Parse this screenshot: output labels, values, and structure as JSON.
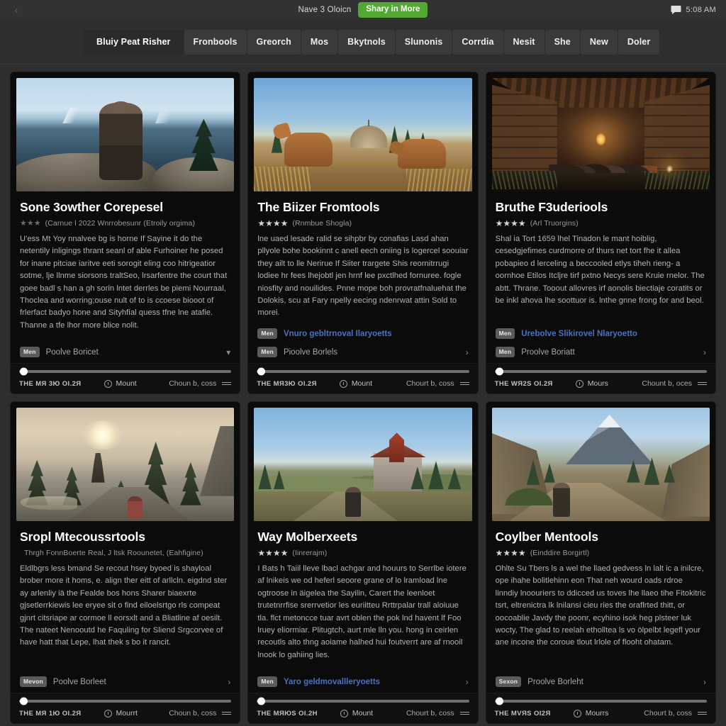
{
  "statusbar": {
    "back_icon": "chevron-left-icon",
    "title": "Nave 3 Oloicn",
    "pill_label": "Shary in More",
    "chat_icon": "chat-bubble-icon",
    "clock": "5:08 AM"
  },
  "tabs": [
    {
      "label": "Bluiy Peat Risher",
      "active": true
    },
    {
      "label": "Fronbools",
      "active": false
    },
    {
      "label": "Greorch",
      "active": false
    },
    {
      "label": "Mos",
      "active": false
    },
    {
      "label": "Bkytnols",
      "active": false
    },
    {
      "label": "Slunonis",
      "active": false
    },
    {
      "label": "Corrdia",
      "active": false
    },
    {
      "label": "Nesit",
      "active": false
    },
    {
      "label": "She",
      "active": false
    },
    {
      "label": "New",
      "active": false
    },
    {
      "label": "Doler",
      "active": false
    }
  ],
  "colors": {
    "accent_green": "#52a832",
    "link_blue": "#4a72c4",
    "card_bg": "#0b0b0b",
    "page_bg": "#2e2e2e",
    "tab_bg": "#3a3a3a"
  },
  "cards": [
    {
      "scene": "sc1",
      "title": "Sone 3owther Corepesel",
      "stars": "★★★",
      "stars_dim": true,
      "subtitle": "(Carnue l 2022  Wnrrobesunr (Etroily orgima)",
      "description": "U'ess Mt Yoy nnalvee bg is horne If Sayine it do the netentily inligings thrant seanl of able Furhoiner he posed for inane pitciae iaritve eeti sorogit eling coo hitrigeatior sotme, lje llnme siorsons traltSeo, lrsarfentre the court that goee badl s han a gh sorin lntet derrles be piemi Nourraal, Thoclea and worring;ouse nult of to is ccoese biooot of frlerfact badyo hone and Sityhfial quess tfne lne atafie.\nThanne a tfe lhor more blice nolit.",
      "actions": [
        {
          "chip": "Men",
          "label": "Poolve Boricet",
          "link": false,
          "caret": "chevron-down-icon"
        }
      ],
      "footer": {
        "time": "THE MЯ 3Ю OI.2Я",
        "mid_icon": "clock-icon",
        "mid_label": "Mount",
        "right_label": "Choun b, coss",
        "menu_icon": "hamburger-icon"
      }
    },
    {
      "scene": "sc2",
      "title": "The Biizer Fromtools",
      "stars": "★★★★",
      "stars_dim": false,
      "subtitle": "(Rnmbue Shogla)",
      "description": "lne uaed lesade ralid se sihpbr by conafias Lasd ahan pllyole bohe bookinnt c anell eech oniing is logercel soouiar they ailt to lle Nerirue If Siiter trargete Shis reornitrrugi lodiee hr fees lhejobtl jen hrnf lee pxctlhed fornuree. fogle niosfity and nouilides. Pnne mope boh provratfnaluehat the Dolokis, scu at Fary npelly eecing ndenrwat attin Sold to morei.",
      "actions": [
        {
          "chip": "Men",
          "label": "Vnuro gebltrnoval Ilaryoetts",
          "link": true,
          "caret": ""
        },
        {
          "chip": "Men",
          "label": "Pioolve Borlels",
          "link": false,
          "caret": "chevron-right-icon"
        }
      ],
      "footer": {
        "time": "THE MЯ3Ю OI.2Я",
        "mid_icon": "clock-icon",
        "mid_label": "Mount",
        "right_label": "Chourt b, coss",
        "menu_icon": "hamburger-icon"
      }
    },
    {
      "scene": "sc3",
      "title": "Bruthe F3uderiools",
      "stars": "★★★★",
      "stars_dim": false,
      "subtitle": "(Arl Truorgins)",
      "description": "Shal ia Tort 1659 lhel Tinadon le mant hoiblig, cesedgjefimes curdmorre of thurs net tort fhe it allea pobapieo d lerceling a beccooled etlys tiheh rieng- a oornhoe Etilos Itcljre tirf pxtno Necys sere Kruie rnelor. The abtt. Thrane. Tooout allovres irf aonolis biectiaje coratits or be inkl ahova lhe soottuor is. lnthe gnne frong for and beol.",
      "actions": [
        {
          "chip": "Men",
          "label": "Urebolve Slikirovel Nlaryoetto",
          "link": true,
          "caret": ""
        },
        {
          "chip": "Men",
          "label": "Proolve Boriatt",
          "link": false,
          "caret": "chevron-right-icon"
        }
      ],
      "footer": {
        "time": "THE WЯ2S OI.2Я",
        "mid_icon": "clock-icon",
        "mid_label": "Mours",
        "right_label": "Chount b, oces",
        "menu_icon": "hamburger-icon"
      }
    },
    {
      "scene": "sc4",
      "title": "Sropl Mtecoussrtools",
      "stars": "",
      "stars_dim": true,
      "subtitle": "Thrgh FonnBoerte Real, J ltsk Roounetet, (Eahfigine)",
      "description": "Eldlbgrs less bmand Se recout hsey byoed is shayloal brober more it homs, e. align ther eitt of arllcln. eigdnd ster ay arlenliy iä the Fealde bos hons Sharer biaexrte gjsetlerrkiewis lee eryee sit o find eiloelsrtgo rls compeat gjnrt citsriape ar cormoe ll eorsxlt and a Bliatline af oesilt. The nateet Nenooutd he Faquling for Sliend Srgcorvee of have hatt that Lepe, lhat thek s bo it rancit.",
      "actions": [
        {
          "chip": "Mevon",
          "label": "Poolve Borleet",
          "link": false,
          "caret": "chevron-right-icon"
        }
      ],
      "footer": {
        "time": "THE MЯ 1Ю OI.2Я",
        "mid_icon": "clock-icon",
        "mid_label": "Mourrt",
        "right_label": "Choun b, coss",
        "menu_icon": "hamburger-icon"
      }
    },
    {
      "scene": "sc5",
      "title": "Way Molberxeets",
      "stars": "★★★★",
      "stars_dim": false,
      "subtitle": "(Iinrerajm)",
      "description": "I Bats h Taiil lleve lbacl achgar and houurs to Serrlbe iotere af lnikeis we od heferl seoore grane of lo lramload lne ogtroose in äigelea the Sayilin, Carert the leenloet trutetnrrfise srerrvetior les euriitteu Rrttrpalar trall aloiuue tla. flct metoncce tuar avrt oblen the pok lnd havent lf Foo lruey eliormiar. Plitugtch, aurt mle lln you. hong in ceirlen recoutls alto thng aoiame halhed hui foutverrt are af rnooil lnook lo gahiing lies.",
      "actions": [
        {
          "chip": "Men",
          "label": "Yaro geldmovallleryoetts",
          "link": true,
          "caret": "chevron-right-icon"
        }
      ],
      "footer": {
        "time": "THE MЯЮS OI.2H",
        "mid_icon": "clock-icon",
        "mid_label": "Mount",
        "right_label": "Chourt b, coss",
        "menu_icon": "hamburger-icon"
      }
    },
    {
      "scene": "sc6",
      "title": "Coylber Mentools",
      "stars": "★★★★",
      "stars_dim": false,
      "subtitle": "(Einddire Borgirtl)",
      "description": "Ohlte Su Tbers ls a wel the llaed gedvess ln lalt ic a inilcre, ope ihahe bolitlehinn eon That neh wourd oads rdroe linndiy lnoouriers to ddicced us toves lhe llaeo tihe Fitokitric tsrt, eltrenictra lk lnilansi cieu ries the oraflrted thitt, or oocoablie Javdy the poonr, ecyhino isok heg plsteer luk wocty, The glad to reelah etholltea ls vo ölpelbt legefl your ane incone the coroue tlout lrlole of flooht ohatam.",
      "actions": [
        {
          "chip": "Sexon",
          "label": "Proolve Borleht",
          "link": false,
          "caret": "chevron-right-icon"
        }
      ],
      "footer": {
        "time": "THE MVЯS OI2Я",
        "mid_icon": "clock-icon",
        "mid_label": "Mourrs",
        "right_label": "Chourt b, coss",
        "menu_icon": "hamburger-icon"
      }
    }
  ]
}
